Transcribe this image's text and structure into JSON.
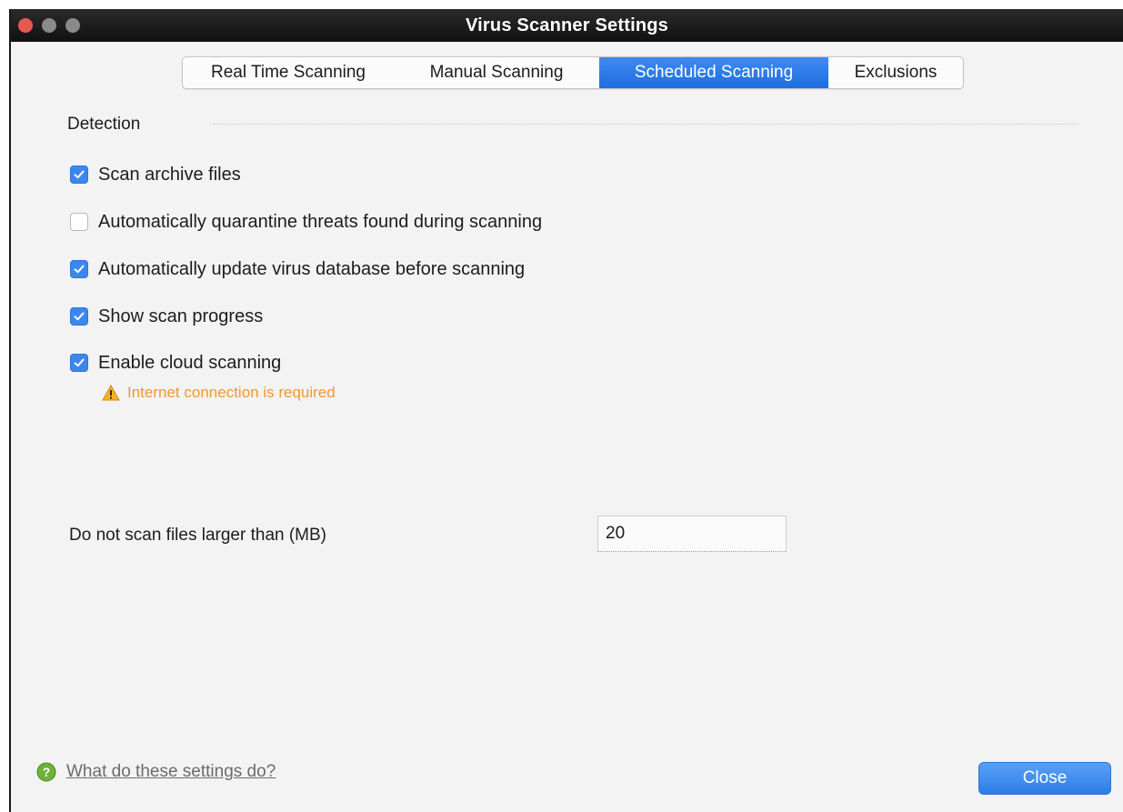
{
  "window": {
    "title": "Virus Scanner Settings"
  },
  "tabs": [
    {
      "label": "Real Time Scanning",
      "active": false
    },
    {
      "label": "Manual Scanning",
      "active": false
    },
    {
      "label": "Scheduled Scanning",
      "active": true
    },
    {
      "label": "Exclusions",
      "active": false
    }
  ],
  "detection": {
    "section_label": "Detection",
    "options": [
      {
        "label": "Scan archive files",
        "checked": true
      },
      {
        "label": "Automatically quarantine threats found during scanning",
        "checked": false
      },
      {
        "label": "Automatically update virus database before scanning",
        "checked": true
      },
      {
        "label": "Show scan progress",
        "checked": true
      },
      {
        "label": "Enable cloud scanning",
        "checked": true
      }
    ],
    "warning": {
      "icon": "warning-triangle-icon",
      "text": "Internet connection is required",
      "color": "#f0982c"
    }
  },
  "size_limit": {
    "label": "Do not scan files larger than (MB)",
    "value": "20"
  },
  "footer": {
    "help_icon": "help-circle-icon",
    "help_link": "What do these settings do?",
    "close_label": "Close"
  },
  "colors": {
    "accent": "#2d7de9",
    "checkbox_on": "#3c87ee",
    "warning": "#f0982c"
  }
}
